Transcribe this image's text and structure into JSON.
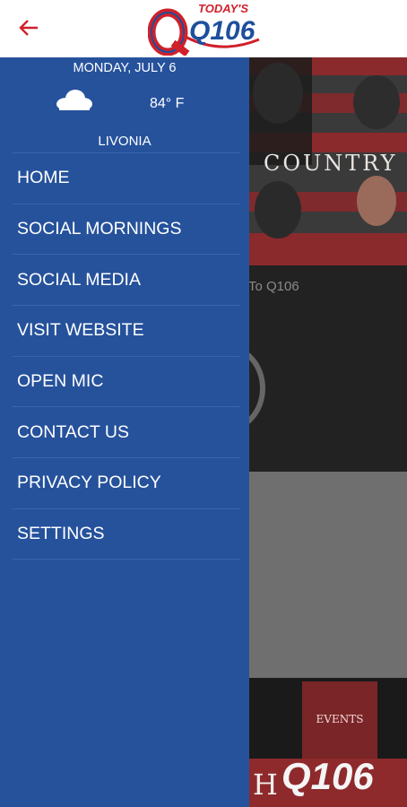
{
  "header": {
    "logo_top": "TODAY'S",
    "logo_main": "Q106"
  },
  "drawer": {
    "date": "MONDAY, JULY 6",
    "temperature": "84° F",
    "location": "LIVONIA",
    "weather_icon": "cloud-icon",
    "items": [
      {
        "label": "HOME"
      },
      {
        "label": "SOCIAL MORNINGS"
      },
      {
        "label": "SOCIAL MEDIA"
      },
      {
        "label": "VISIT WEBSITE"
      },
      {
        "label": "OPEN MIC"
      },
      {
        "label": "CONTACT US"
      },
      {
        "label": "PRIVACY POLICY"
      },
      {
        "label": "SETTINGS"
      }
    ]
  },
  "background": {
    "hero_text": "COUNTRY",
    "listen_text": "To Q106",
    "events_label": "EVENTS",
    "strip_text": "H",
    "strip_logo": "Q106"
  },
  "colors": {
    "drawer": "#26529c",
    "accent": "#d0202a"
  }
}
